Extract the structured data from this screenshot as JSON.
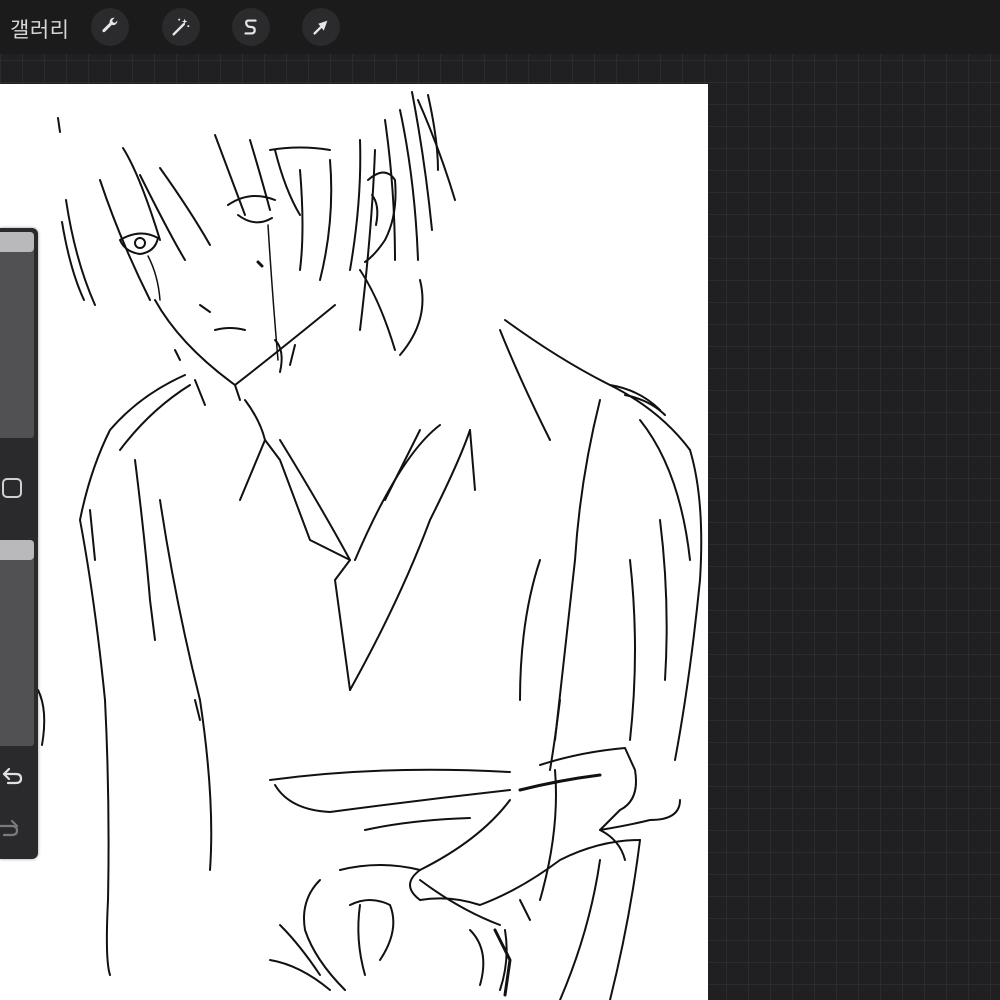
{
  "toolbar": {
    "gallery_label": "갤러리",
    "tools": [
      {
        "name": "actions",
        "icon": "wrench-icon"
      },
      {
        "name": "adjustments",
        "icon": "magic-wand-icon"
      },
      {
        "name": "selection",
        "icon": "selection-s-icon"
      },
      {
        "name": "transform",
        "icon": "arrow-cursor-icon"
      }
    ]
  },
  "sidebar": {
    "brush_size_level": 1.0,
    "opacity_level": 1.0,
    "modify_icon": "square-icon",
    "undo_icon": "undo-icon",
    "redo_icon": "redo-icon"
  },
  "colors": {
    "toolbar_bg": "#1b1b1c",
    "workspace_bg": "#202022",
    "canvas_bg": "#ffffff",
    "ink": "#111111"
  }
}
